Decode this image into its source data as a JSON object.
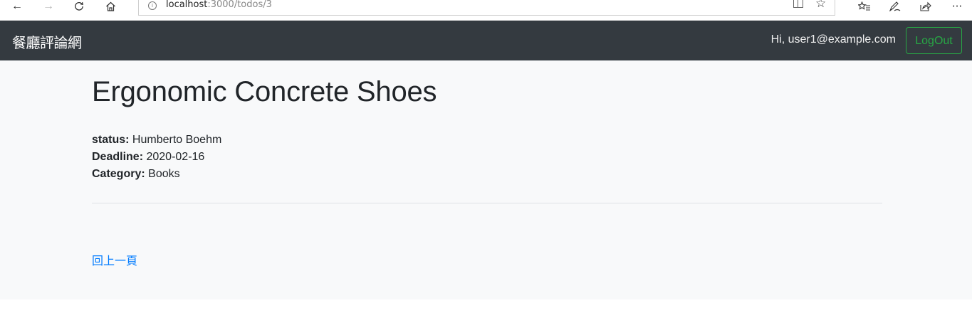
{
  "browser": {
    "url_host": "localhost",
    "url_rest": ":3000/todos/3",
    "icons": {
      "back": "arrow-left-icon",
      "forward": "arrow-right-icon",
      "refresh": "refresh-icon",
      "home": "home-icon",
      "info": "info-icon",
      "reading_view": "reading-view-icon",
      "favorite": "star-icon",
      "favorites_list": "favorites-list-icon",
      "pen": "pen-icon",
      "share": "share-icon",
      "more": "more-icon"
    }
  },
  "navbar": {
    "brand": "餐廳評論網",
    "greeting": "Hi, user1@example.com",
    "logout_label": "LogOut",
    "colors": {
      "background": "#343a40",
      "logout": "#28a745"
    }
  },
  "todo": {
    "title": "Ergonomic Concrete Shoes",
    "fields": [
      {
        "label": "status:",
        "value": "Humberto Boehm"
      },
      {
        "label": "Deadline:",
        "value": "2020-02-16"
      },
      {
        "label": "Category:",
        "value": "Books"
      }
    ]
  },
  "footer": {
    "back_label": "回上一頁",
    "link_color": "#007bff"
  }
}
